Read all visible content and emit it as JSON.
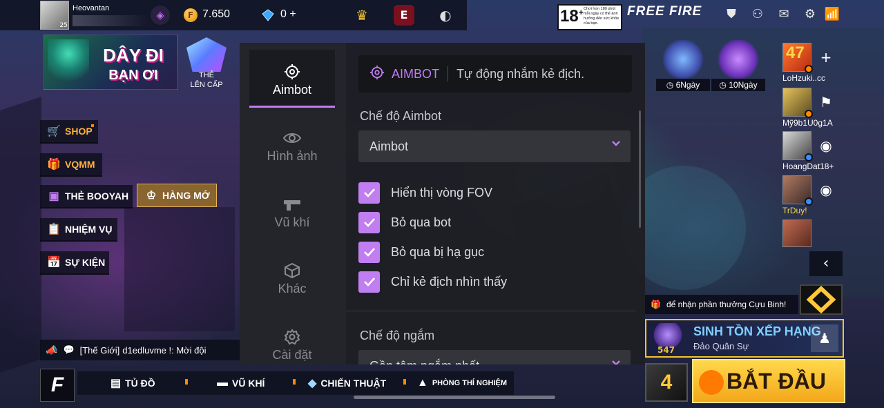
{
  "user": {
    "name": "Heovantan",
    "level": "25"
  },
  "currency": {
    "gold": "7.650",
    "diamonds": "0",
    "diamond_add": "+"
  },
  "age_rating": {
    "number": "18",
    "plus": "+",
    "text": "Chơi hơn 180 phút mỗi ngày có thể ảnh hưởng đến sức khỏe của bạn."
  },
  "brand": "FREE FIRE",
  "promo": {
    "title_line1": "DÂY ĐI",
    "title_line2": "BẠN ƠI",
    "upgrade_line1": "THẺ",
    "upgrade_line2": "LÊN CẤP"
  },
  "left_menu": [
    {
      "label": "SHOP",
      "icon": "cart-icon"
    },
    {
      "label": "VQMM",
      "icon": "gift-wheel-icon"
    },
    {
      "label": "THẺ BOOYAH",
      "icon": "booyah-card-icon"
    },
    {
      "label": "HÀNG MỚ",
      "icon": "crown-icon"
    },
    {
      "label": "NHIỆM VỤ",
      "icon": "clipboard-icon"
    },
    {
      "label": "SỰ KIỆN",
      "icon": "calendar-icon"
    }
  ],
  "chat": {
    "channel": "[Thế Giới]",
    "message": "d1edluvme !: Mời đội"
  },
  "bottom_nav": [
    {
      "label": "TỦ ĐỒ",
      "icon": "wardrobe-icon"
    },
    {
      "label": "VŨ KHÍ",
      "icon": "gun-icon"
    },
    {
      "label": "CHIẾN THUẬT",
      "icon": "cards-icon"
    },
    {
      "label": "PHÒNG THÍ NGHIỆM",
      "icon": "lab-icon"
    }
  ],
  "events": [
    {
      "days": "6Ngày"
    },
    {
      "days": "10Ngày"
    }
  ],
  "friends": [
    {
      "name": "LoHzuki..cc",
      "badge": "47",
      "action": "+"
    },
    {
      "name": "Mỹ9b1U0g1A",
      "action": "pin-icon"
    },
    {
      "name": "HoangDat18+",
      "action": "eye-icon"
    },
    {
      "name": "TrDuy!",
      "action": "eye-icon"
    }
  ],
  "reward_text": "để nhận phần thưởng Cựu Binh!",
  "mode": {
    "title": "SINH TỒN XẾP HẠNG",
    "map": "Đảo Quân Sự",
    "rank_points": "547"
  },
  "dice_count": "4",
  "start_label": "BẮT ĐẦU",
  "settings": {
    "tabs": [
      {
        "label": "Aimbot",
        "icon": "crosshair-icon",
        "active": true
      },
      {
        "label": "Hình ảnh",
        "icon": "eye-icon",
        "active": false
      },
      {
        "label": "Vũ khí",
        "icon": "gun-icon",
        "active": false
      },
      {
        "label": "Khác",
        "icon": "box-icon",
        "active": false
      },
      {
        "label": "Cài đặt",
        "icon": "gear-icon",
        "active": false
      }
    ],
    "header": {
      "title": "AIMBOT",
      "description": "Tự động nhắm kẻ địch."
    },
    "mode_label": "Chế độ Aimbot",
    "mode_value": "Aimbot",
    "options": [
      {
        "label": "Hiển thị vòng FOV",
        "checked": true
      },
      {
        "label": "Bỏ qua bot",
        "checked": true
      },
      {
        "label": "Bỏ qua bị hạ gục",
        "checked": true
      },
      {
        "label": "Chỉ kẻ địch nhìn thấy",
        "checked": true
      }
    ],
    "aim_label": "Chế độ ngắm",
    "aim_value": "Gần tâm ngắm nhất"
  },
  "colors": {
    "accent": "#c07ef0",
    "gold": "#f3c531",
    "panel": "#1e1f24"
  }
}
